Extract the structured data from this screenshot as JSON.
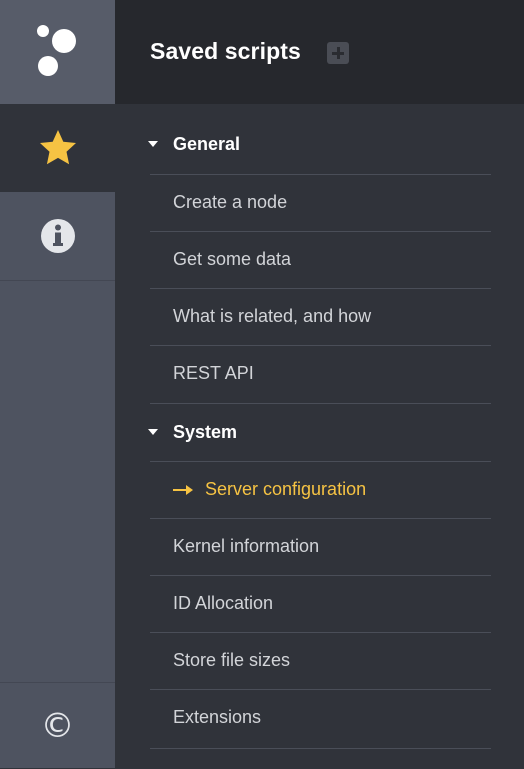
{
  "header": {
    "title": "Saved scripts"
  },
  "sidebar": {
    "logo": "app-logo",
    "items": [
      {
        "name": "favorites",
        "icon": "star-icon",
        "active": true
      },
      {
        "name": "info",
        "icon": "info-icon",
        "active": false
      }
    ],
    "bottom": {
      "glyph": "©",
      "icon": "copyright-icon"
    }
  },
  "groups": [
    {
      "label": "General",
      "items": [
        "Create a node",
        "Get some data",
        "What is related, and how",
        "REST API"
      ]
    },
    {
      "label": "System",
      "items": [
        "Server configuration",
        "Kernel information",
        "ID Allocation",
        "Store file sizes",
        "Extensions"
      ]
    }
  ],
  "active_item": "Server configuration",
  "colors": {
    "accent": "#f6c343",
    "panel": "#30333a",
    "rail": "#4e5360",
    "header": "#26282d"
  }
}
